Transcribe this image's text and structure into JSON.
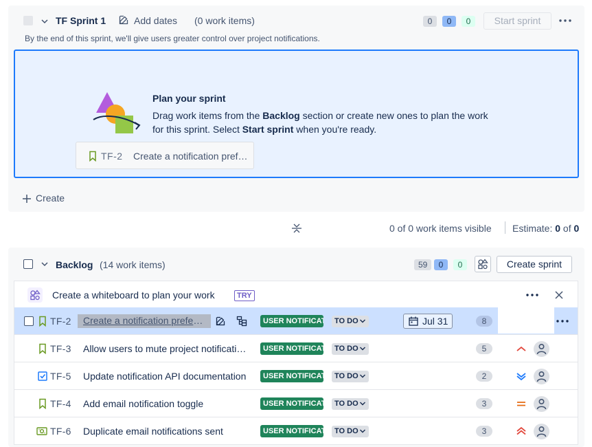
{
  "sprint": {
    "title": "TF Sprint 1",
    "add_dates": "Add dates",
    "count": "(0 work items)",
    "goal": "By the end of this sprint, we'll give users greater control over project notifications.",
    "counts": [
      "0",
      "0",
      "0"
    ],
    "start_button": "Start sprint",
    "plan_title": "Plan your sprint",
    "plan_text_1": "Drag work items from the ",
    "plan_text_backlog": "Backlog",
    "plan_text_2": " section or create new ones to plan the work for this sprint. Select ",
    "plan_text_start": "Start sprint",
    "plan_text_3": " when you're ready.",
    "ghost_card": {
      "key": "TF-2",
      "summary": "Create a notification preferences page"
    },
    "create_label": "Create"
  },
  "visibility": {
    "visible": "0 of 0 work items visible",
    "estimate_label": "Estimate: ",
    "estimate_done": "0",
    "estimate_of": " of ",
    "estimate_total": "0"
  },
  "backlog": {
    "title": "Backlog",
    "count": "(14 work items)",
    "counts": [
      "59",
      "0",
      "0"
    ],
    "create_sprint": "Create sprint",
    "whiteboard_banner": "Create a whiteboard to plan your work",
    "try_badge": "TRY",
    "items": [
      {
        "key": "TF-2",
        "summary": "Create a notification preferences page",
        "type": "story",
        "epic": "USER NOTIFICATIONS",
        "status": "TO DO",
        "due": "Jul 31",
        "estimate": "8",
        "priority": "none"
      },
      {
        "key": "TF-3",
        "summary": "Allow users to mute project notifications",
        "type": "story",
        "epic": "USER NOTIFICATIONS",
        "status": "TO DO",
        "estimate": "5",
        "priority": "high"
      },
      {
        "key": "TF-5",
        "summary": "Update notification API documentation",
        "type": "task",
        "epic": "USER NOTIFICATIONS",
        "status": "TO DO",
        "estimate": "2",
        "priority": "lowest"
      },
      {
        "key": "TF-4",
        "summary": "Add email notification toggle",
        "type": "story",
        "epic": "USER NOTIFICATIONS",
        "status": "TO DO",
        "estimate": "3",
        "priority": "medium"
      },
      {
        "key": "TF-6",
        "summary": "Duplicate email notifications sent",
        "type": "bug",
        "epic": "USER NOTIFICATIONS",
        "status": "TO DO",
        "estimate": "3",
        "priority": "highest"
      }
    ]
  },
  "colors": {
    "accent": "#1d7afc",
    "epic": "#1f845a",
    "story": "#6a9a23",
    "task": "#1d7afc",
    "bug": "#6a9a23",
    "priority_high": "#e2483d",
    "priority_low": "#1d7afc",
    "priority_medium": "#e56910"
  }
}
